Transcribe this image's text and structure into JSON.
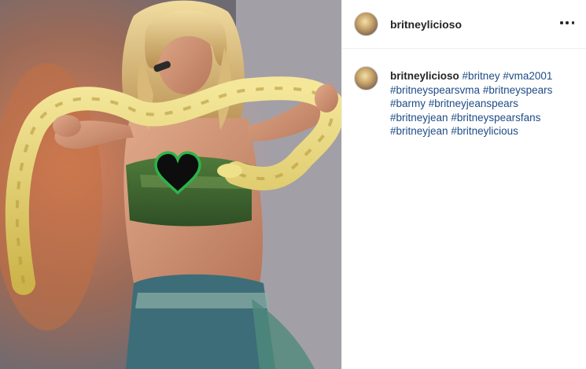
{
  "post": {
    "username": "britneylicioso",
    "more_icon": "more-horizontal-icon",
    "caption": {
      "username": "britneylicioso",
      "hashtags": [
        "#britney",
        "#vma2001",
        "#britneyspearsvma",
        "#britneyspears",
        "#barmy",
        "#britneyjeanspears",
        "#britneyjean",
        "#britneyspearsfans",
        "#britneyjean",
        "#britneylicious"
      ]
    }
  },
  "colors": {
    "hashtag": "#1e4b87",
    "text": "#262626",
    "divider": "#efefef",
    "heart_outline": "#2db34a"
  }
}
